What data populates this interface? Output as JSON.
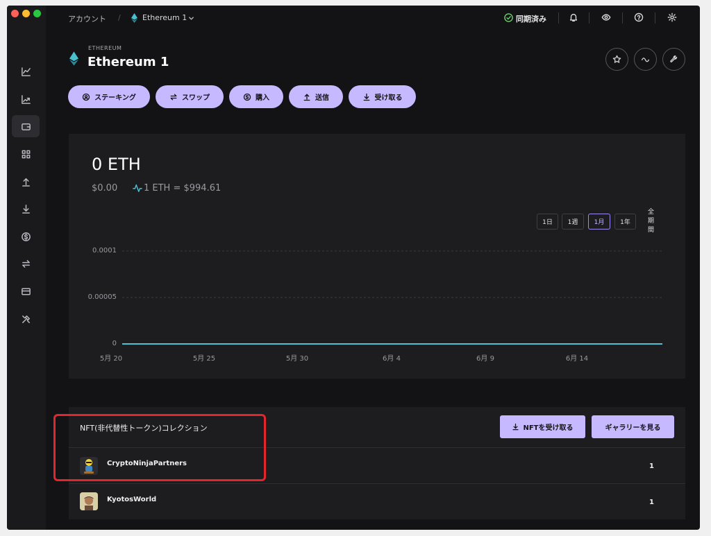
{
  "topbar": {
    "breadcrumb_root": "アカウント",
    "breadcrumb_separator": "/",
    "account_name": "Ethereum 1",
    "sync_status": "同期済み",
    "icons": [
      "bell-icon",
      "eye-icon",
      "help-icon",
      "settings-icon"
    ]
  },
  "sidebar": {
    "items": [
      {
        "icon": "portfolio-icon"
      },
      {
        "icon": "market-icon"
      },
      {
        "icon": "accounts-icon",
        "active": true
      },
      {
        "icon": "discover-icon"
      },
      {
        "icon": "send-icon"
      },
      {
        "icon": "receive-icon"
      },
      {
        "icon": "buy-icon"
      },
      {
        "icon": "swap-icon"
      },
      {
        "icon": "card-icon"
      },
      {
        "icon": "tools-icon"
      }
    ]
  },
  "account": {
    "currency_label": "ETHEREUM",
    "name": "Ethereum 1"
  },
  "actions": {
    "staking": "ステーキング",
    "swap": "スワップ",
    "buy": "購入",
    "send": "送信",
    "receive": "受け取る"
  },
  "balance": {
    "crypto": "0 ETH",
    "fiat": "$0.00",
    "rate": "1 ETH = $994.61"
  },
  "ranges": {
    "day": "1日",
    "week": "1週",
    "month": "1月",
    "year": "1年",
    "all_1": "全",
    "all_2": "期",
    "all_3": "間",
    "selected": "1月"
  },
  "colors": {
    "accent": "#c7b9ff",
    "line": "#4fc2d1",
    "sync_ok": "#6bd36b",
    "eth_teal": "#49c0d0"
  },
  "chart_data": {
    "type": "line",
    "x": [
      "5月 20",
      "5月 25",
      "5月 30",
      "6月 4",
      "6月 9",
      "6月 14"
    ],
    "y_ticks": [
      "0.0001",
      "0.00005",
      "0"
    ],
    "ylim": [
      0,
      0.0001
    ],
    "series": [
      {
        "values": [
          0,
          0,
          0,
          0,
          0,
          0,
          0
        ]
      }
    ],
    "grid": true
  },
  "nft": {
    "title": "NFT(非代替性トークン)コレクション",
    "receive_button": "NFTを受け取る",
    "gallery_button": "ギャラリーを見る",
    "collections": [
      {
        "name": "CryptoNinjaPartners",
        "count": "1"
      },
      {
        "name": "KyotosWorld",
        "count": "1"
      }
    ]
  }
}
